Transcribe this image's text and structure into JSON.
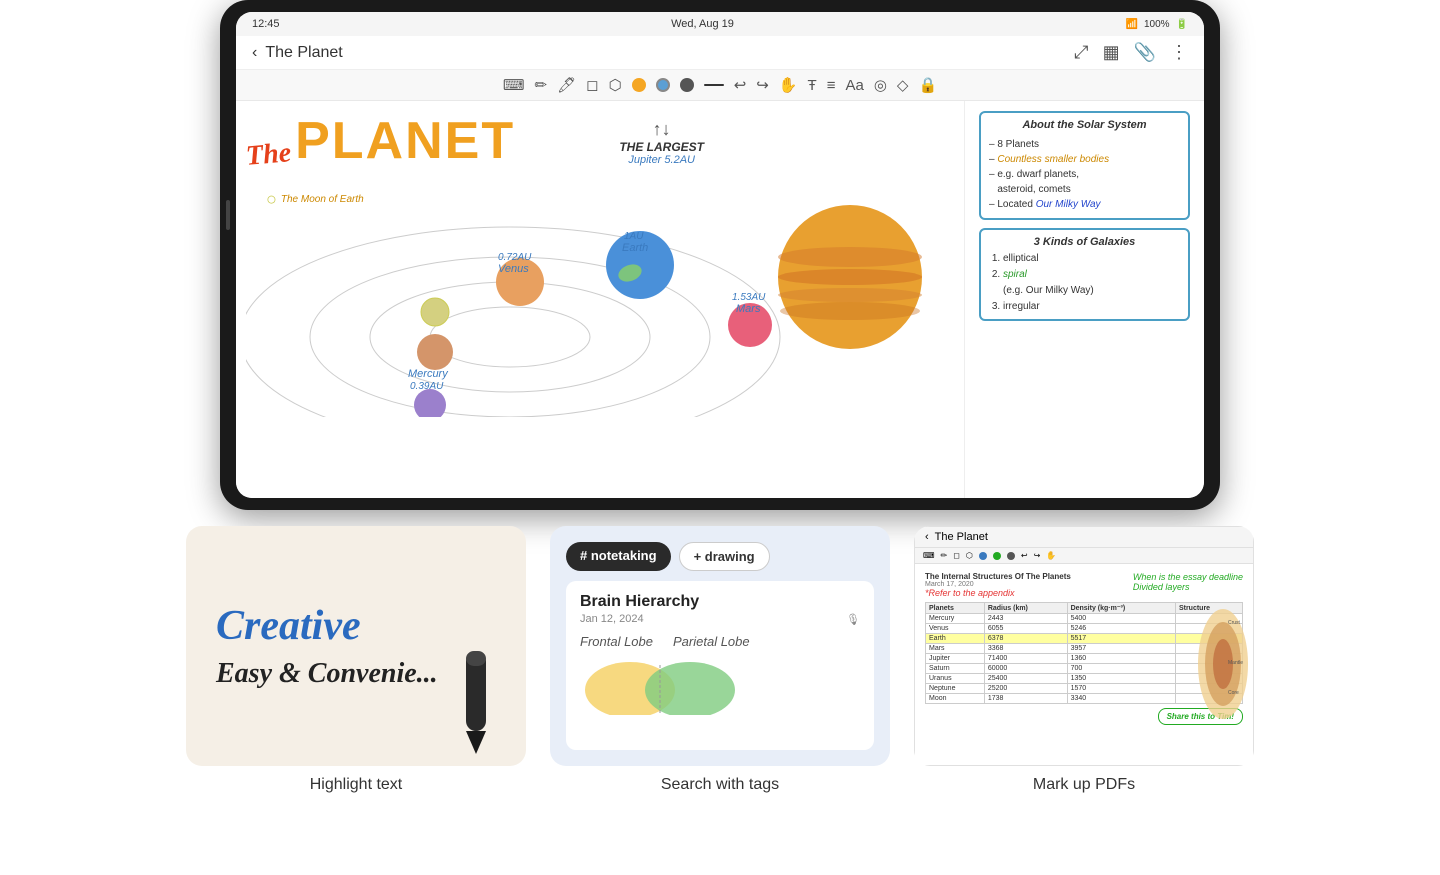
{
  "tablet": {
    "status": {
      "time": "12:45",
      "date": "Wed, Aug 19",
      "battery": "100%",
      "signal": "📶"
    },
    "nav": {
      "back_label": "< The Planet",
      "title": "The Planet"
    },
    "toolbar": {
      "colors": [
        "#f5a623",
        "#5b9fd4",
        "#555555"
      ],
      "tools": [
        "keyboard",
        "pencil",
        "pen",
        "eraser",
        "lasso",
        "undo",
        "redo",
        "hand",
        "text",
        "text2",
        "label",
        "layout",
        "shape",
        "lock"
      ]
    },
    "note": {
      "title_the": "The",
      "title_planet": "PLANET",
      "largest_title": "THE LARGEST",
      "largest_sub": "Jupiter 5.2AU",
      "moon_label": "The Moon of Earth",
      "planets": [
        {
          "name": "Mercury",
          "au": "0.39AU"
        },
        {
          "name": "Venus",
          "au": "0.72AU"
        },
        {
          "name": "Earth",
          "au": "1AU"
        },
        {
          "name": "Mars",
          "au": "1.53AU"
        }
      ]
    },
    "right_notes": {
      "about_title": "About the Solar System",
      "about_items": [
        "8 Planets",
        "Countless smaller bodies",
        "e.g. dwarf planets, asteroid, comets",
        "Located Our Milky Way"
      ],
      "galaxies_title": "3 Kinds of Galaxies",
      "galaxies_items": [
        "elliptical",
        "spiral (e.g. Our Milky Way)",
        "irregular"
      ]
    }
  },
  "features": [
    {
      "id": "highlight",
      "label": "Highlight text",
      "creative": "Creative",
      "easy": "Easy & Convenie..."
    },
    {
      "id": "search",
      "label": "Search with tags",
      "tags": [
        "# notetaking",
        "+ drawing"
      ],
      "note_title": "Brain Hierarchy",
      "note_date": "Jan 12, 2024",
      "note_sections": [
        "Frontal Lobe",
        "Parietal Lobe"
      ]
    },
    {
      "id": "markup",
      "label": "Mark up PDFs",
      "nav_title": "The Planet",
      "pdf_title": "The Internal Structures Of The Planets",
      "pdf_date": "March 17, 2020",
      "pdf_subtitle": "*Refer to the appendix",
      "annotation1": "When is the essay deadline",
      "annotation2": "Divided layers",
      "share_text": "Share this to Tim!",
      "table_headers": [
        "Planets",
        "Radius (km)",
        "Density (kg·m⁻³)",
        "Structure of the"
      ],
      "table_rows": [
        {
          "planet": "Mercury",
          "radius": "2443",
          "density": "5400"
        },
        {
          "planet": "Venus",
          "radius": "6055",
          "density": "5246"
        },
        {
          "planet": "Earth",
          "radius": "6378",
          "density": "5517",
          "highlight": true
        },
        {
          "planet": "Mars",
          "radius": "3368",
          "density": "3957"
        },
        {
          "planet": "Jupiter",
          "radius": "71400",
          "density": "1360"
        },
        {
          "planet": "Saturn",
          "radius": "60000",
          "density": "700"
        },
        {
          "planet": "Uranus",
          "radius": "25400",
          "density": "1350"
        },
        {
          "planet": "Neptune",
          "radius": "25200",
          "density": "1570"
        },
        {
          "planet": "Moon",
          "radius": "1738",
          "density": "3340"
        }
      ]
    }
  ]
}
